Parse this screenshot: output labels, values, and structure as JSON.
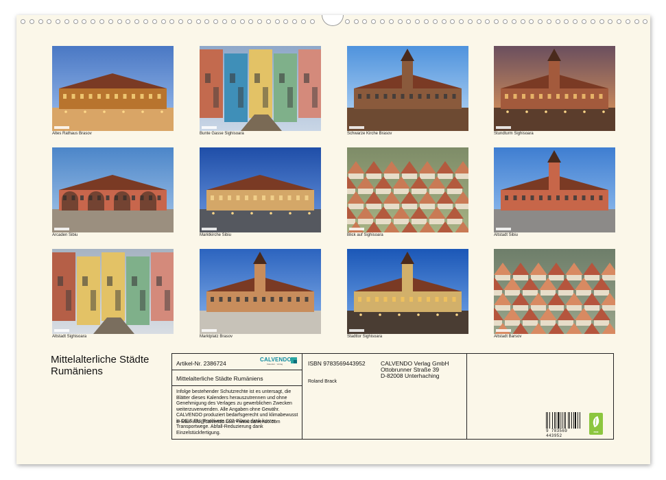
{
  "photos": [
    {
      "caption": "Altes Rathaus Brasov"
    },
    {
      "caption": "Bunte Gasse Sighisoara"
    },
    {
      "caption": "Schwarze Kirche Brasov"
    },
    {
      "caption": "Stundturm Sighisoara"
    },
    {
      "caption": "Arcaden Sibiu"
    },
    {
      "caption": "Marktkirche Sibiu"
    },
    {
      "caption": "Blick auf Sighisoara"
    },
    {
      "caption": "Altstadt Sibiu"
    },
    {
      "caption": "Altstadt Sighisoara"
    },
    {
      "caption": "Marktplatz Brasov"
    },
    {
      "caption": "Stadttor Sighisoara"
    },
    {
      "caption": "Altstadt Barsov"
    }
  ],
  "title": "Mittelalterliche Städte Rumäniens",
  "info": {
    "article_label": "Artikel-Nr. 2386724",
    "logo_text": "CALVENDO",
    "logo_sub": "Kalender · Verlag",
    "product_title": "Mittelalterliche Städte Rumäniens",
    "legal_text": "Infolge bestehender Schutzrechte ist es untersagt, die Blätter dieses Kalenders herauszutrennen und ohne Genehmigung des Verlages zu gewerblichen Zwecken weiterzuverwenden. Alle Angaben ohne Gewähr. CALVENDO produziert bedarfsgerecht und klimabewusst in DE & EU. Positivere C02-Bilanz dank kurzer Transportwege. Abfall-Reduzierung dank Einzelstückfertigung.",
    "contact": "E-Mail: info@calvendo.com • www.calvendo.com",
    "isbn": "ISBN 9783569443952",
    "author": "Roland Brack",
    "publisher_name": "CALVENDO Verlag GmbH",
    "publisher_street": "Ottobrunner Straße 39",
    "publisher_city": "D-82008 Unterhaching",
    "barcode_number": "9 783569 443952",
    "eco_label": "eco"
  }
}
